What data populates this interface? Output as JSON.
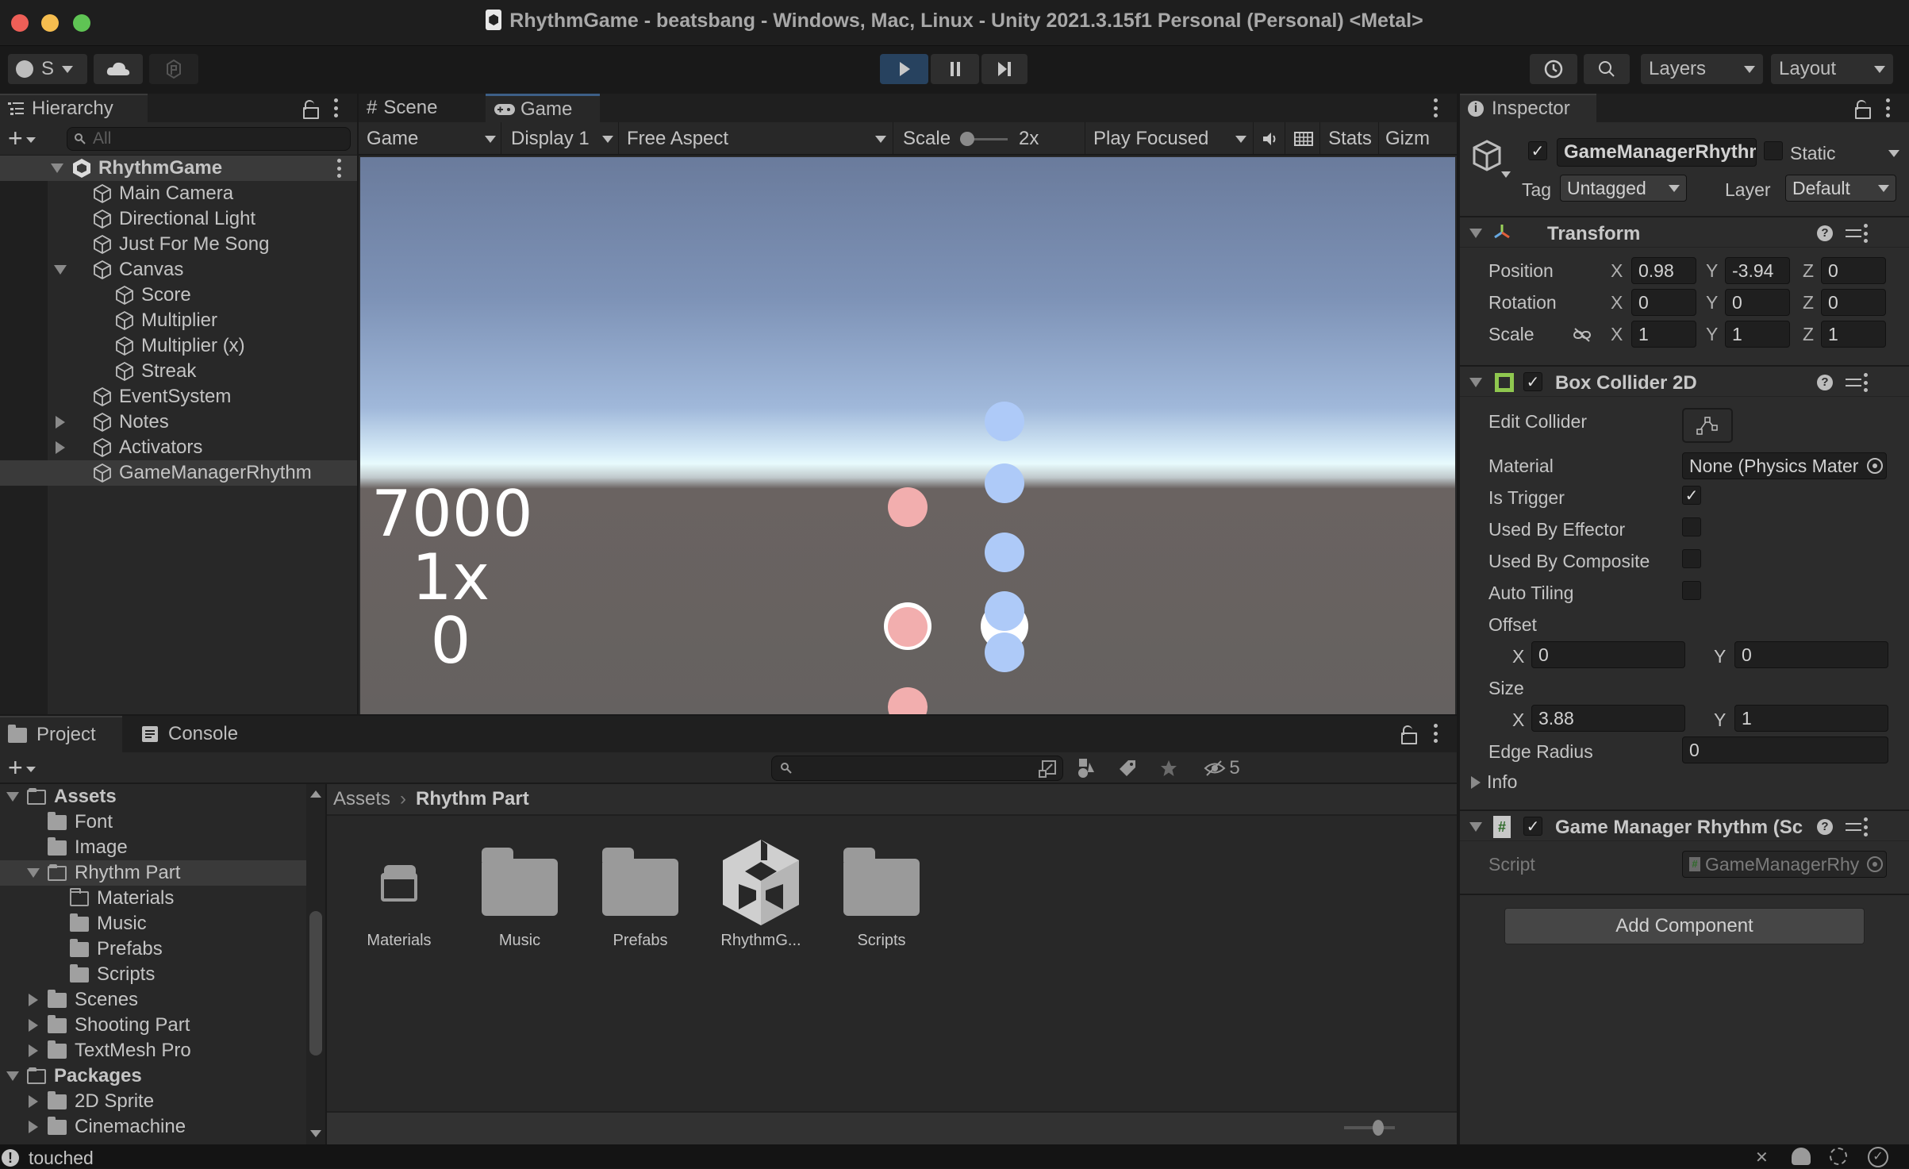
{
  "window": {
    "title": "RhythmGame - beatsbang - Windows, Mac, Linux - Unity 2021.3.15f1 Personal (Personal) <Metal>",
    "traffic_lights": {
      "close": "#ee5f57",
      "minimize": "#f5bd4f",
      "zoom": "#5fc454"
    }
  },
  "toolbar": {
    "account_label": "S",
    "cloud_icon": "cloud-icon",
    "collab_icon": "plastic-scm-icon",
    "play_icon": "play-icon",
    "pause_icon": "pause-icon",
    "step_icon": "step-icon",
    "history_icon": "undo-history-icon",
    "search_icon": "search-icon",
    "layers_label": "Layers",
    "layout_label": "Layout",
    "play_active_color": "#27425f"
  },
  "hierarchy": {
    "tab_label": "Hierarchy",
    "search_placeholder": "All",
    "scene_name": "RhythmGame",
    "items": [
      {
        "label": "Main Camera",
        "depth": 1,
        "expander": "none"
      },
      {
        "label": "Directional Light",
        "depth": 1,
        "expander": "none"
      },
      {
        "label": "Just For Me Song",
        "depth": 1,
        "expander": "none"
      },
      {
        "label": "Canvas",
        "depth": 1,
        "expander": "expanded"
      },
      {
        "label": "Score",
        "depth": 2,
        "expander": "none"
      },
      {
        "label": "Multiplier",
        "depth": 2,
        "expander": "none"
      },
      {
        "label": "Multiplier (x)",
        "depth": 2,
        "expander": "none"
      },
      {
        "label": "Streak",
        "depth": 2,
        "expander": "none"
      },
      {
        "label": "EventSystem",
        "depth": 1,
        "expander": "none"
      },
      {
        "label": "Notes",
        "depth": 1,
        "expander": "collapsed"
      },
      {
        "label": "Activators",
        "depth": 1,
        "expander": "collapsed"
      },
      {
        "label": "GameManagerRhythm",
        "depth": 1,
        "expander": "none",
        "selected": true
      }
    ]
  },
  "game_view": {
    "tabs": [
      {
        "label": "Scene",
        "icon": "scene-grid-icon",
        "active": false
      },
      {
        "label": "Game",
        "icon": "gamepad-icon",
        "active": true
      }
    ],
    "controls": {
      "view_mode": "Game",
      "display": "Display 1",
      "aspect": "Free Aspect",
      "scale_label": "Scale",
      "scale_value": "2x",
      "play_mode": "Play Focused",
      "stats_label": "Stats",
      "gizmos_label": "Gizm"
    },
    "hud": {
      "score": "7000",
      "multiplier": "1x",
      "streak": "0"
    },
    "notes": {
      "red_lane": {
        "color": "#f2aeae",
        "count": 3
      },
      "blue_lane": {
        "color": "#aecaf8",
        "count": 5
      }
    }
  },
  "inspector": {
    "tab_label": "Inspector",
    "object": {
      "active": true,
      "name": "GameManagerRhythm",
      "static_label": "Static",
      "static": false,
      "tag_label": "Tag",
      "tag_value": "Untagged",
      "layer_label": "Layer",
      "layer_value": "Default"
    },
    "transform": {
      "title": "Transform",
      "rows": [
        {
          "label": "Position",
          "x": "0.98",
          "y": "-3.94",
          "z": "0"
        },
        {
          "label": "Rotation",
          "x": "0",
          "y": "0",
          "z": "0"
        },
        {
          "label": "Scale",
          "x": "1",
          "y": "1",
          "z": "1"
        }
      ]
    },
    "box_collider": {
      "title": "Box Collider 2D",
      "enabled": true,
      "edit_collider_label": "Edit Collider",
      "material_label": "Material",
      "material_value": "None (Physics Mater",
      "is_trigger_label": "Is Trigger",
      "is_trigger": true,
      "used_by_effector_label": "Used By Effector",
      "used_by_effector": false,
      "used_by_composite_label": "Used By Composite",
      "used_by_composite": false,
      "auto_tiling_label": "Auto Tiling",
      "auto_tiling": false,
      "offset_label": "Offset",
      "offset_x": "0",
      "offset_y": "0",
      "size_label": "Size",
      "size_x": "3.88",
      "size_y": "1",
      "edge_radius_label": "Edge Radius",
      "edge_radius": "0",
      "info_label": "Info",
      "accent_color": "#8fc74f"
    },
    "script_component": {
      "title": "Game Manager Rhythm (Sc",
      "enabled": true,
      "script_label": "Script",
      "script_value": "GameManagerRhy"
    },
    "add_component_label": "Add Component"
  },
  "project": {
    "tabs": [
      {
        "label": "Project",
        "active": true
      },
      {
        "label": "Console",
        "active": false
      }
    ],
    "hidden_count": "5",
    "tree": [
      {
        "label": "Assets",
        "depth": 0,
        "expander": "expanded",
        "bold": true,
        "folder": "open"
      },
      {
        "label": "Font",
        "depth": 1,
        "expander": "none",
        "folder": "filled"
      },
      {
        "label": "Image",
        "depth": 1,
        "expander": "none",
        "folder": "filled"
      },
      {
        "label": "Rhythm Part",
        "depth": 1,
        "expander": "expanded",
        "folder": "open",
        "selected": true
      },
      {
        "label": "Materials",
        "depth": 2,
        "expander": "none",
        "folder": "outline"
      },
      {
        "label": "Music",
        "depth": 2,
        "expander": "none",
        "folder": "filled"
      },
      {
        "label": "Prefabs",
        "depth": 2,
        "expander": "none",
        "folder": "filled"
      },
      {
        "label": "Scripts",
        "depth": 2,
        "expander": "none",
        "folder": "filled"
      },
      {
        "label": "Scenes",
        "depth": 1,
        "expander": "collapsed",
        "folder": "filled"
      },
      {
        "label": "Shooting Part",
        "depth": 1,
        "expander": "collapsed",
        "folder": "filled"
      },
      {
        "label": "TextMesh Pro",
        "depth": 1,
        "expander": "collapsed",
        "folder": "filled"
      },
      {
        "label": "Packages",
        "depth": 0,
        "expander": "expanded",
        "bold": true,
        "folder": "open"
      },
      {
        "label": "2D Sprite",
        "depth": 1,
        "expander": "collapsed",
        "folder": "filled"
      },
      {
        "label": "Cinemachine",
        "depth": 1,
        "expander": "collapsed",
        "folder": "filled"
      }
    ],
    "breadcrumb": [
      "Assets",
      "Rhythm Part"
    ],
    "assets": [
      {
        "label": "Materials",
        "type": "empty-folder"
      },
      {
        "label": "Music",
        "type": "folder"
      },
      {
        "label": "Prefabs",
        "type": "folder"
      },
      {
        "label": "RhythmG...",
        "type": "unity-scene"
      },
      {
        "label": "Scripts",
        "type": "folder"
      }
    ]
  },
  "status_bar": {
    "message": "touched",
    "message_icon": "warning-icon"
  }
}
